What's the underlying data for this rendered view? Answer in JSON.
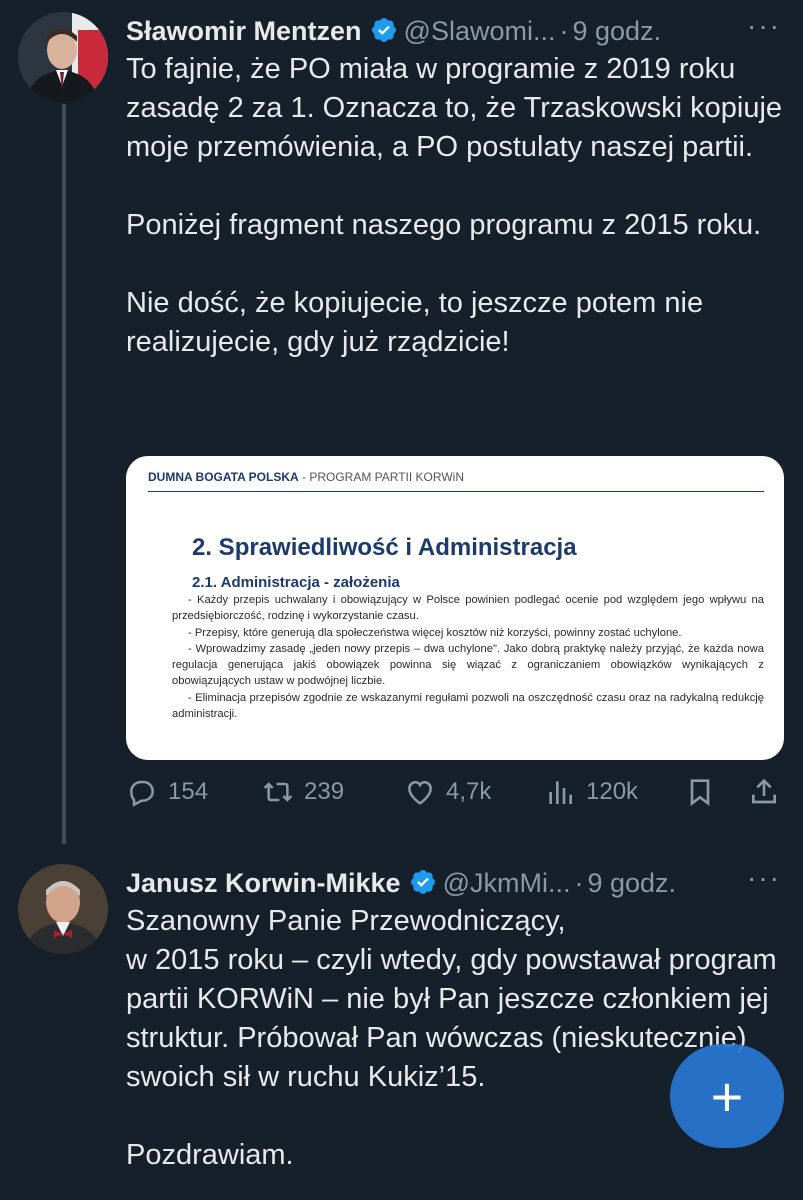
{
  "tweets": [
    {
      "name": "Sławomir Mentzen",
      "handle": "@Slawomi...",
      "separator": "·",
      "time": "9 godz.",
      "more": "···",
      "text": "To fajnie, że PO miała w programie z 2019 roku zasadę 2 za 1. Oznacza to, że Trzaskowski kopiuje moje przemówienia, a PO postulaty naszej partii.\n\nPoniżej fragment naszego programu z 2015 roku.\n\nNie dość, że kopiujecie, to jeszcze potem nie realizujecie, gdy już rządzicie!",
      "media": {
        "header_bold": "DUMNA BOGATA POLSKA",
        "header_rest": " - PROGRAM PARTII KORWiN",
        "title": "2. Sprawiedliwość i Administracja",
        "subtitle": "2.1. Administracja - założenia",
        "paragraphs": [
          "- Każdy przepis uchwalany i obowiązujący w Polsce powinien podlegać ocenie pod względem jego wpływu na przedsiębiorczość, rodzinę i wykorzystanie czasu.",
          "- Przepisy, które generują dla społeczeństwa więcej kosztów niż korzyści, powinny zostać uchylone.",
          "- Wprowadzimy zasadę „jeden nowy przepis – dwa uchylone\". Jako dobrą praktykę należy przyjąć, że każda nowa regulacja generująca jakiś obowiązek powinna się wiązać z ograniczaniem obowiązków wynikających z obowiązujących ustaw w podwójnej liczbie.",
          "- Eliminacja przepisów zgodnie ze wskazanymi regułami pozwoli na oszczędność czasu oraz na radykalną redukcję administracji."
        ]
      },
      "stats": {
        "replies": "154",
        "retweets": "239",
        "likes": "4,7k",
        "views": "120k"
      }
    },
    {
      "name": "Janusz Korwin-Mikke",
      "handle": "@JkmMi...",
      "separator": "·",
      "time": "9 godz.",
      "more": "···",
      "text": "Szanowny Panie Przewodniczący,\nw 2015 roku – czyli wtedy, gdy powstawał program partii KORWiN – nie był Pan jeszcze członkiem jej struktur. Próbował Pan wówczas (nieskutecznie) swoich sił w ruchu Kukiz’15.\n\nPozdrawiam."
    }
  ],
  "compose_button": "+",
  "colors": {
    "background": "#15202b",
    "text": "#e7e9ea",
    "muted": "#8b98a5",
    "verified": "#1d9bf0",
    "fab": "#2878d2"
  },
  "icons": {
    "reply": "reply-icon",
    "retweet": "retweet-icon",
    "like": "heart-icon",
    "views": "views-icon",
    "bookmark": "bookmark-icon",
    "share": "share-icon",
    "verified": "verified-badge-icon"
  }
}
